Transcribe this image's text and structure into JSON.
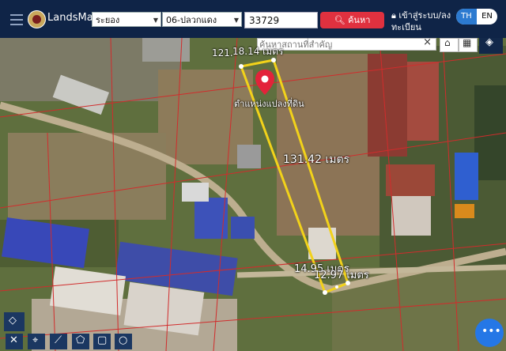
{
  "header": {
    "brand": "LandsMaps",
    "province": "ระยอง",
    "district": "06-ปลวกแดง",
    "parcel_number": "33729",
    "search_label": "ค้นหา",
    "login_line1": "เข้าสู่ระบบ/ลง",
    "login_line2": "ทะเบียน",
    "lang_th": "TH",
    "lang_en": "EN"
  },
  "map": {
    "place_search_placeholder": "ค้นหาสถานที่สำคัญ",
    "marker_label": "ตำแหน่งแปลงที่ดิน",
    "measurements": {
      "top_left": "121.",
      "top": "18.14 เมตร",
      "side": "131.42 เมตร",
      "bottom_1": "14.95 เมตร",
      "bottom_2": "12.97 เมตร"
    }
  },
  "colors": {
    "topbar": "#0f2447",
    "search_button": "#e0313f",
    "parcel_outline": "#f2d21a",
    "fab": "#2577e6"
  },
  "icons": [
    "hamburger-icon",
    "logo-icon",
    "search-icon",
    "user-lock-icon",
    "map-pin-icon",
    "clear-icon",
    "home-icon",
    "grid-icon",
    "layers-icon",
    "measure-icon",
    "location-icon",
    "line-icon",
    "polygon-icon",
    "square-icon",
    "circle-icon",
    "more-icon"
  ]
}
